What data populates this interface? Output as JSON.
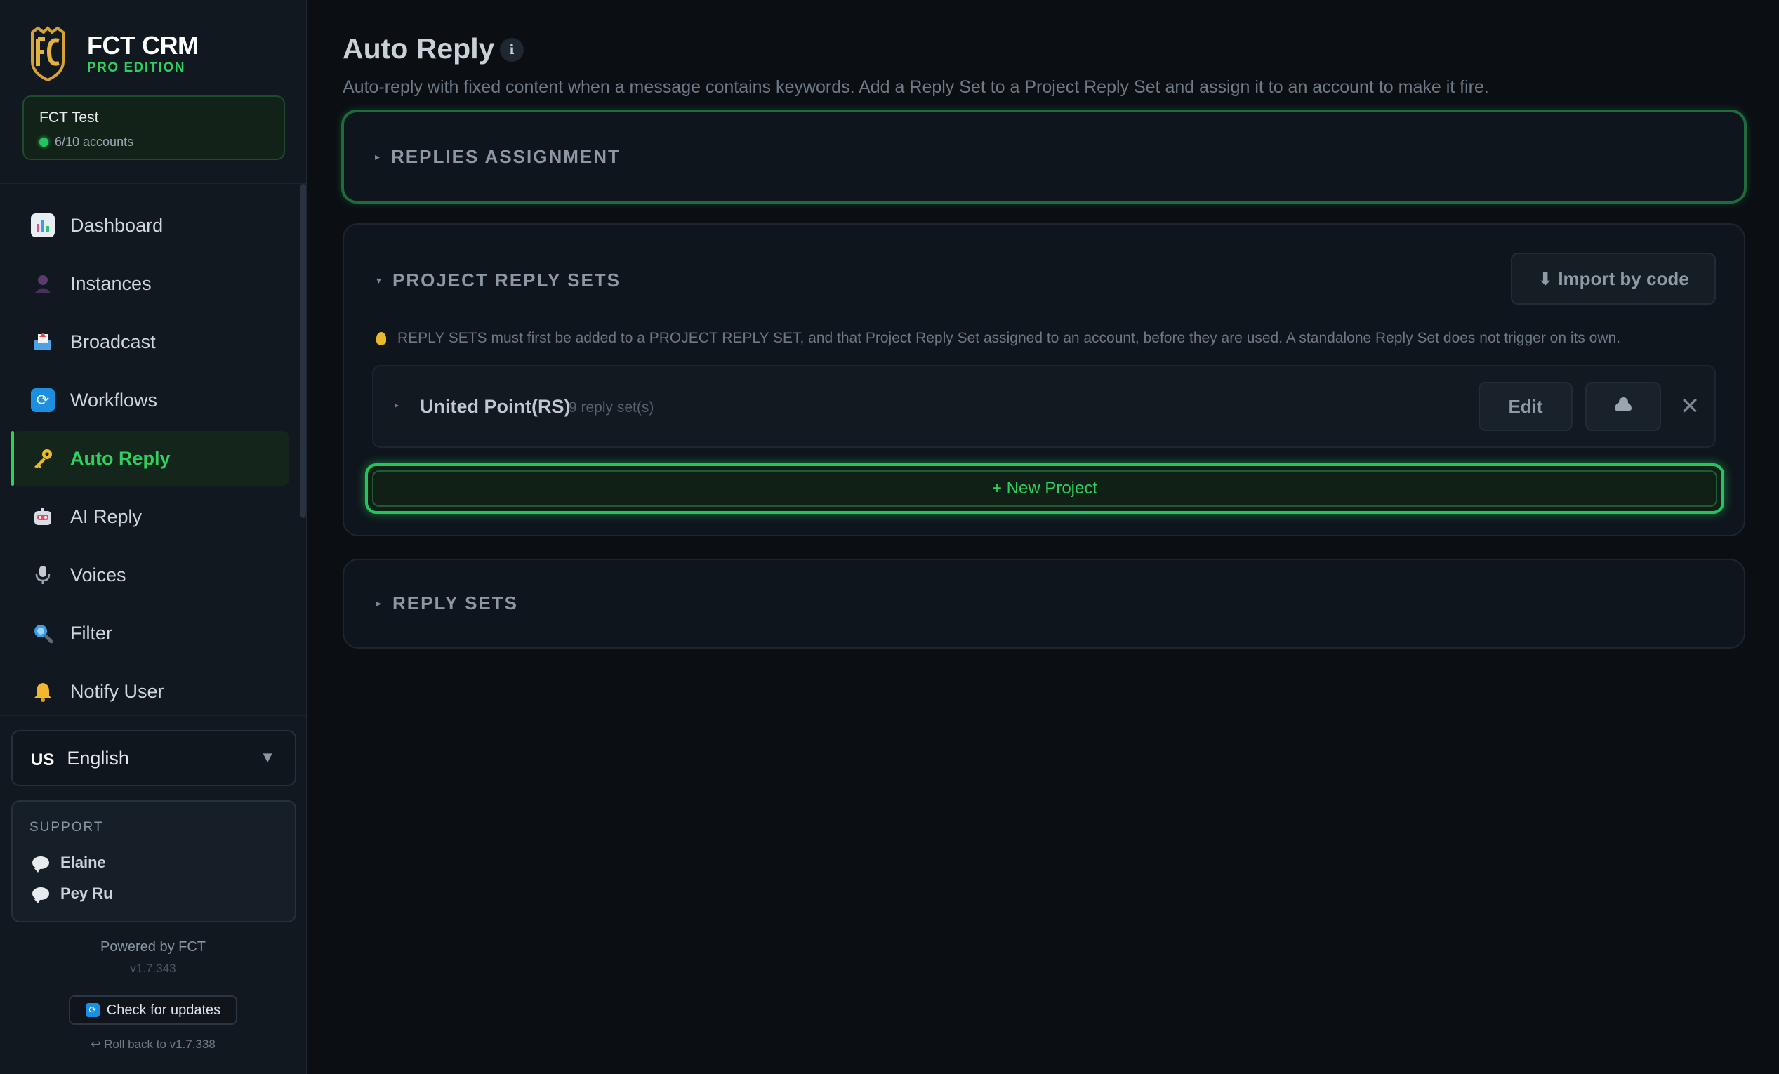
{
  "brand": {
    "title": "FCT CRM",
    "subtitle": "PRO EDITION"
  },
  "account": {
    "name": "FCT Test",
    "count": "6/10 accounts"
  },
  "nav": {
    "items": [
      {
        "label": "Dashboard",
        "icon": "dashboard-chart-icon"
      },
      {
        "label": "Instances",
        "icon": "person-icon"
      },
      {
        "label": "Broadcast",
        "icon": "outbox-icon"
      },
      {
        "label": "Workflows",
        "icon": "refresh-icon"
      },
      {
        "label": "Auto Reply",
        "icon": "key-icon",
        "active": true
      },
      {
        "label": "AI Reply",
        "icon": "robot-icon"
      },
      {
        "label": "Voices",
        "icon": "microphone-icon"
      },
      {
        "label": "Filter",
        "icon": "magnifier-icon"
      },
      {
        "label": "Notify User",
        "icon": "bell-icon"
      }
    ]
  },
  "language": {
    "flag": "US",
    "label": "English"
  },
  "support": {
    "title": "SUPPORT",
    "contacts": [
      "Elaine",
      "Pey Ru"
    ]
  },
  "footer": {
    "powered": "Powered by FCT",
    "version": "v1.7.343",
    "update_label": "Check for updates",
    "rollback_label": "↩ Roll back to v1.7.338"
  },
  "page": {
    "title": "Auto Reply",
    "info": "i",
    "description": "Auto-reply with fixed content when a message contains keywords. Add a Reply Set to a Project Reply Set and assign it to an account to make it fire."
  },
  "sections": {
    "assignment": {
      "title": "REPLIES ASSIGNMENT",
      "expanded": false
    },
    "project_sets": {
      "title": "PROJECT REPLY SETS",
      "expanded": true,
      "import_label": "⬇ Import by code",
      "hint": "REPLY SETS must first be added to a PROJECT REPLY SET, and that Project Reply Set assigned to an account, before they are used. A standalone Reply Set does not trigger on its own.",
      "projects": [
        {
          "name": "United Point(RS)",
          "count": "9 reply set(s)",
          "edit_label": "Edit",
          "delete_label": "✕"
        }
      ],
      "new_label": "+ New Project"
    },
    "reply_sets": {
      "title": "REPLY SETS",
      "expanded": false
    }
  },
  "colors": {
    "accent": "#22c55e",
    "background": "#0b0f14",
    "sidebar": "#111820",
    "panel": "#0f151c"
  }
}
